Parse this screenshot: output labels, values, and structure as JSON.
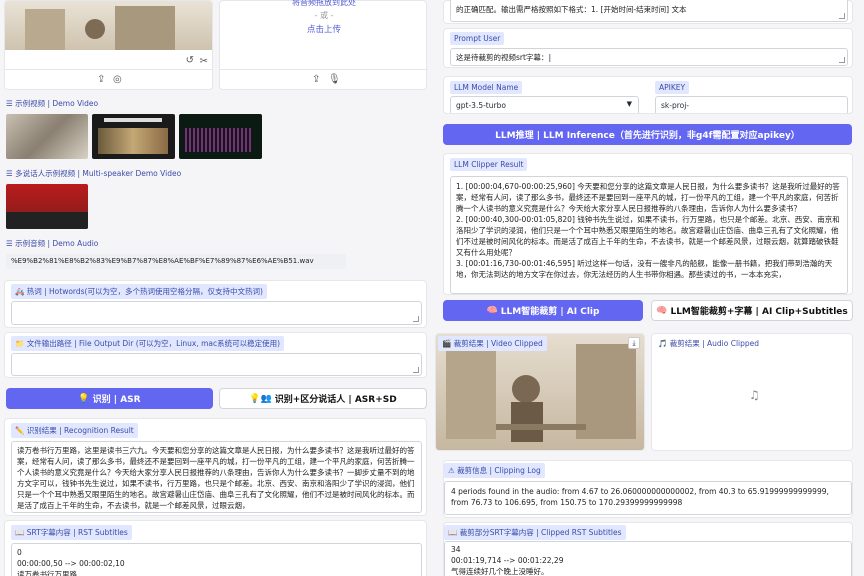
{
  "upload": {
    "drop_hint": "将音频拖放到此处",
    "or": "- 或 -",
    "click_upload": "点击上传"
  },
  "demo_video": {
    "label": "示例视频 | Demo Video"
  },
  "multi_speaker": {
    "label": "多说话人示例视频 | Multi-speaker Demo Video"
  },
  "demo_audio": {
    "label": "示例音频 | Demo Audio",
    "file": "%E9%B2%81%E8%B2%83%E9%B7%87%E8%AE%BF%E7%89%87%E6%AE%B51.wav"
  },
  "hotwords": {
    "label": "热词 | Hotwords(可以为空，多个热词使用空格分隔，仅支持中文热词)"
  },
  "output_dir": {
    "label": "文件输出路径 | File Output Dir (可以为空，Linux, mac系统可以稳定使用)"
  },
  "asr_buttons": {
    "asr": "识别 | ASR",
    "asr_sd": "识别+区分说话人 | ASR+SD"
  },
  "recognition": {
    "label": "识别结果 | Recognition Result",
    "text": "读万卷书行万里路，这里是读书三六九。今天要和您分享的这篇文章是人民日报，为什么要多读书？这是我听过最好的答案，经常有人问，读了那么多书，最终还不是要回到一座平凡的城，打一份平凡的工组，建一个平凡的家庭，何苦折腾一个人读书的意义究竟是什么？今天给大家分享人民日报推荐的八条理由，告诉你人为什么要多读书？一脚步丈量不到的地方文字可以，钱钟书先生说过，如果不读书，行万里路，也只是个邮差。北京、西安、南京和洛阳少了学识的浸润，他们只是一个个耳中熟悉又眼里陌生的地名。故宫避暑山庄岱庙、曲阜三孔有了文化照耀，他们不过是被时间风化的标本。而是活了成百上千年的生命，不去读书，就是一个邮差风景，过眼云烟，"
  },
  "srt": {
    "label": "SRT字幕内容 | RST Subtitles",
    "text": "0\n00:00:00,50 --> 00:00:02,10\n读万卷书行万里路"
  },
  "prompt_system": {
    "text": "的正确匹配。输出需严格按照如下格式：1. [开始时间-结束时间] 文本"
  },
  "prompt_user": {
    "label": "Prompt User",
    "text": "这是待裁剪的视频srt字幕："
  },
  "llm_model": {
    "label": "LLM Model Name",
    "value": "gpt-3.5-turbo"
  },
  "apikey": {
    "label": "APIKEY",
    "value": "sk-proj-"
  },
  "llm_infer": {
    "label": "LLM推理 | LLM Inference（首先进行识别，非g4f需配置对应apikey）"
  },
  "llm_result": {
    "label": "LLM Clipper Result",
    "text": "1. [00:00:04,670-00:00:25,960] 今天要和您分享的这篇文章是人民日报，为什么要多读书？这是我听过最好的答案，经常有人问，读了那么多书，最终还不是要回到一座平凡的城，打一份平凡的工组，建一个平凡的家庭，何苦折腾一个人读书的意义究竟是什么？今天给大家分享人民日报推荐的八条理由，告诉你人为什么要多读书？\n2. [00:00:40,300-00:01:05,820] 钱钟书先生说过，如果不读书，行万里路，也只是个邮差。北京、西安、南京和洛阳少了学识的浸润，他们只是一个个耳中熟悉又眼里陌生的地名。故宫避暑山庄岱庙、曲阜三孔有了文化照耀，他们不过是被时间风化的标本。而是活了成百上千年的生命，不去读书，就是一个邮差风景，过眼云烟，就算踏破铁鞋又有什么用处呢？\n3. [00:01:16,730-00:01:46,595] 听过这样一句话，没有一艘非凡的船舰，能像一册书籍，把我们带到浩瀚的天地，你无法到达的地方文字在你过去，你无法经历的人生书带你相遇。那些读过的书，一本本充实，"
  },
  "clip_buttons": {
    "ai_clip": "LLM智能裁剪 | AI Clip",
    "ai_clip_sub": "LLM智能裁剪+字幕 | AI Clip+Subtitles"
  },
  "video_clipped": {
    "label": "裁剪结果 | Video Clipped"
  },
  "audio_clipped": {
    "label": "裁剪结果 | Audio Clipped"
  },
  "clip_log": {
    "label": "裁剪信息 | Clipping Log",
    "text": "4 periods found in the audio: from 4.67 to 26.060000000000002, from 40.3 to 65.91999999999999, from 76.73 to 106.695, from 150.75 to 170.29399999999998"
  },
  "clipped_srt": {
    "label": "裁剪部分SRT字幕内容 | Clipped RST Subtitles",
    "text": "34\n00:01:19,714 --> 00:01:22,29\n气得连续好几个晚上没睡好。"
  },
  "colors": {
    "accent": "#6366f1",
    "label_bg": "#e0e7ff",
    "label_fg": "#3b4ca8"
  }
}
